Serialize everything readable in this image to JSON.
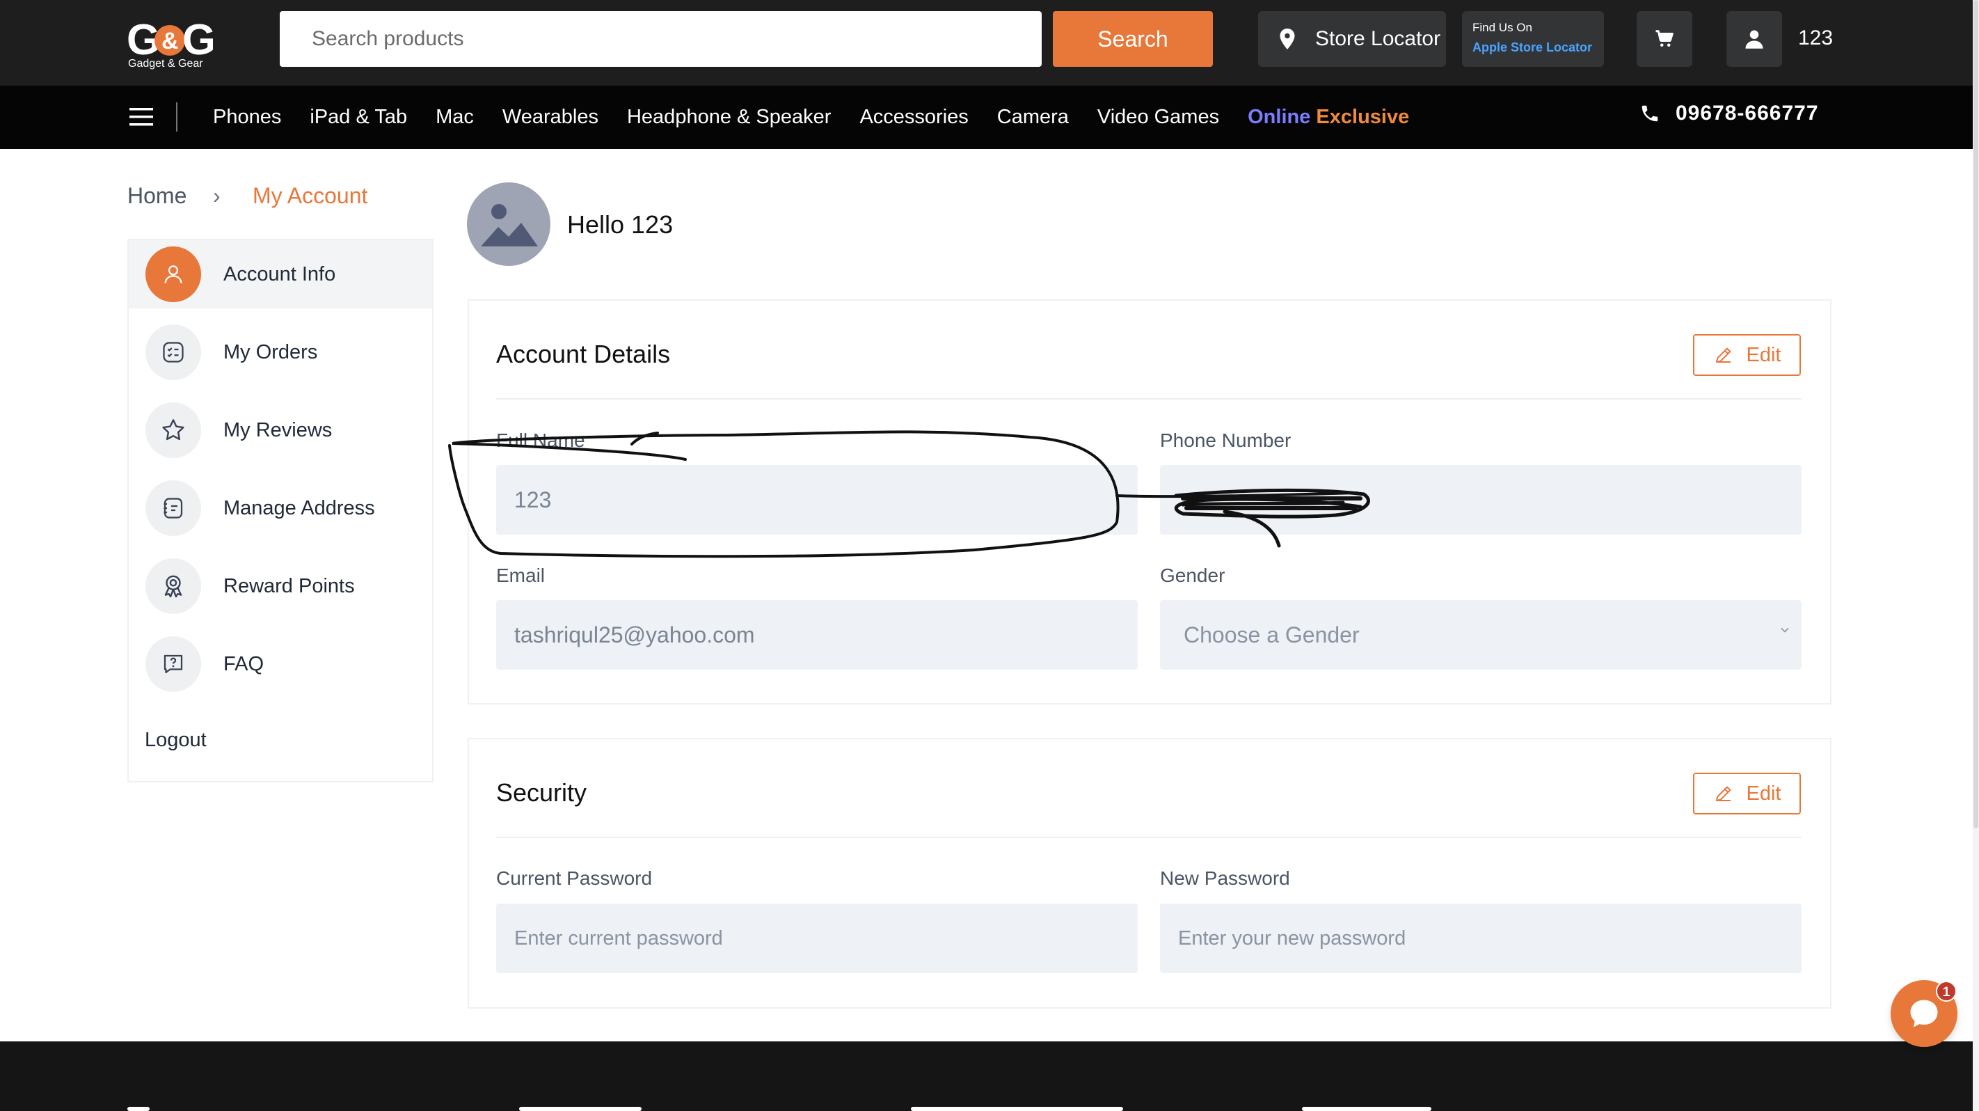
{
  "brand": {
    "logo_text": "G&G",
    "logo_subtitle": "Gadget & Gear",
    "accent": "#e8773a"
  },
  "header": {
    "search_placeholder": "Search products",
    "search_button": "Search",
    "store_locator": "Store Locator",
    "apple_line1": "Find Us On",
    "apple_line2": "Apple Store Locator",
    "user_name": "123"
  },
  "nav": {
    "items": [
      "Phones",
      "iPad & Tab",
      "Mac",
      "Wearables",
      "Headphone & Speaker",
      "Accessories",
      "Camera",
      "Video Games"
    ],
    "exclusive_word1": "Online",
    "exclusive_word2": "Exclusive",
    "phone": "09678-666777"
  },
  "breadcrumb": {
    "home": "Home",
    "separator": "›",
    "current": "My Account"
  },
  "sidebar": {
    "items": [
      {
        "label": "Account Info",
        "icon": "user-icon"
      },
      {
        "label": "My Orders",
        "icon": "orders-list-icon"
      },
      {
        "label": "My Reviews",
        "icon": "star-icon"
      },
      {
        "label": "Manage Address",
        "icon": "address-book-icon"
      },
      {
        "label": "Reward Points",
        "icon": "award-icon"
      },
      {
        "label": "FAQ",
        "icon": "question-bubble-icon"
      }
    ],
    "logout": "Logout"
  },
  "profile": {
    "greeting": "Hello 123"
  },
  "account_details": {
    "title": "Account Details",
    "edit": "Edit",
    "full_name_label": "Full Name",
    "full_name_value": "123",
    "phone_label": "Phone Number",
    "email_label": "Email",
    "email_value": "tashriqul25@yahoo.com",
    "gender_label": "Gender",
    "gender_placeholder": "Choose a Gender"
  },
  "security": {
    "title": "Security",
    "edit": "Edit",
    "current_password_label": "Current Password",
    "current_password_placeholder": "Enter current password",
    "new_password_label": "New Password",
    "new_password_placeholder": "Enter your new password"
  },
  "chat": {
    "badge": "1"
  }
}
